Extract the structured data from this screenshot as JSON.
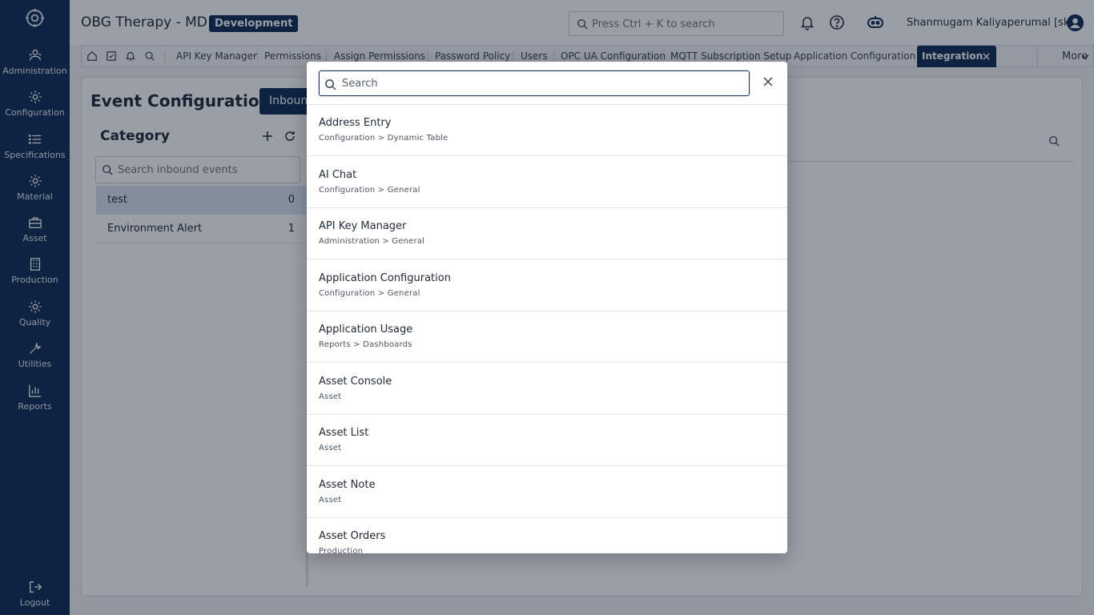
{
  "app": {
    "title": "OBG Therapy - MD",
    "env_badge": "Development"
  },
  "colors": {
    "navy": "#0f2a55",
    "overlay": "rgba(15,25,40,0.42)"
  },
  "sidebar": {
    "items": [
      {
        "label": "Administration",
        "icon": "users-icon"
      },
      {
        "label": "Configuration",
        "icon": "gear-icon"
      },
      {
        "label": "Specifications",
        "icon": "list-icon"
      },
      {
        "label": "Material",
        "icon": "gear-icon"
      },
      {
        "label": "Asset",
        "icon": "briefcase-icon"
      },
      {
        "label": "Production",
        "icon": "building-icon"
      },
      {
        "label": "Quality",
        "icon": "gear-icon"
      },
      {
        "label": "Utilities",
        "icon": "wrench-icon"
      },
      {
        "label": "Reports",
        "icon": "bar-chart-icon"
      }
    ],
    "logout_label": "Logout"
  },
  "header": {
    "search_placeholder": "Press Ctrl + K to search",
    "user_name": "Shanmugam Kaliyaperumal [sk]"
  },
  "tabs": {
    "items": [
      "API Key Manager",
      "Permissions",
      "Assign Permissions",
      "Password Policy",
      "Users",
      "OPC UA Configuration",
      "MQTT Subscription Setup",
      "Application Configuration"
    ],
    "active": "Integration",
    "more": "More"
  },
  "page": {
    "title": "Event Configuration",
    "subtab": "Inbound",
    "category_title": "Category",
    "category_search_placeholder": "Search inbound events",
    "categories": [
      {
        "name": "test",
        "count": "0"
      },
      {
        "name": "Environment Alert",
        "count": "1"
      }
    ]
  },
  "modal": {
    "search_placeholder": "Search",
    "results": [
      {
        "title": "Address Entry",
        "path": "Configuration > Dynamic Table"
      },
      {
        "title": "AI Chat",
        "path": "Configuration > General"
      },
      {
        "title": "API Key Manager",
        "path": "Administration > General"
      },
      {
        "title": "Application Configuration",
        "path": "Configuration > General"
      },
      {
        "title": "Application Usage",
        "path": "Reports > Dashboards"
      },
      {
        "title": "Asset Console",
        "path": "Asset"
      },
      {
        "title": "Asset List",
        "path": "Asset"
      },
      {
        "title": "Asset Note",
        "path": "Asset"
      },
      {
        "title": "Asset Orders",
        "path": "Production"
      }
    ]
  }
}
